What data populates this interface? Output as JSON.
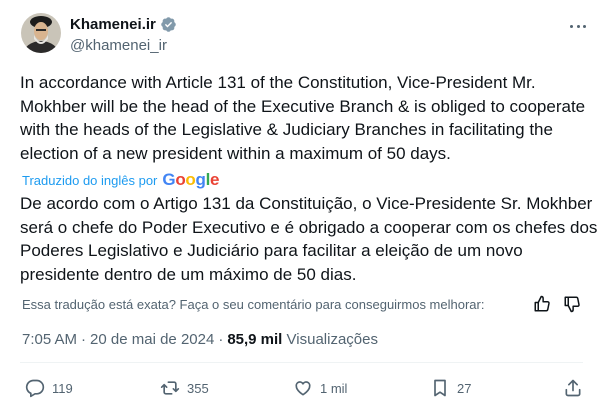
{
  "author": {
    "display_name": "Khamenei.ir",
    "handle": "@khamenei_ir",
    "verified": true
  },
  "tweet": {
    "text_en": "In accordance with Article 131 of the Constitution, Vice-President Mr. Mokhber will be the head of the Executive Branch & is obliged to cooperate with the heads of the Legislative & Judiciary Branches in facilitating the election of a new president within a maximum of 50 days.",
    "translated_label": "Traduzido do inglês por",
    "translator": "Google",
    "text_pt": "De acordo com o Artigo 131 da Constituição, o Vice-Presidente Sr. Mokhber será o chefe do Poder Executivo e é obrigado a cooperar com os chefes dos Poderes Legislativo e Judiciário para facilitar a eleição de um novo presidente dentro de um máximo de 50 dias.",
    "feedback_prompt": "Essa tradução está exata? Faça o seu comentário para conseguirmos melhorar:"
  },
  "meta": {
    "time": "7:05 AM",
    "date": "20 de mai de 2024",
    "views_count": "85,9 mil",
    "views_label": "Visualizações"
  },
  "actions": {
    "replies": "119",
    "retweets": "355",
    "likes": "1 mil",
    "bookmarks": "27"
  },
  "colors": {
    "text": "#0f1419",
    "secondary": "#536471",
    "link": "#1d9bf0",
    "verified": "#829aab"
  },
  "icons": [
    "more-icon",
    "verified-badge-icon",
    "thumbs-up-icon",
    "thumbs-down-icon",
    "reply-icon",
    "retweet-icon",
    "like-icon",
    "bookmark-icon",
    "share-icon"
  ]
}
